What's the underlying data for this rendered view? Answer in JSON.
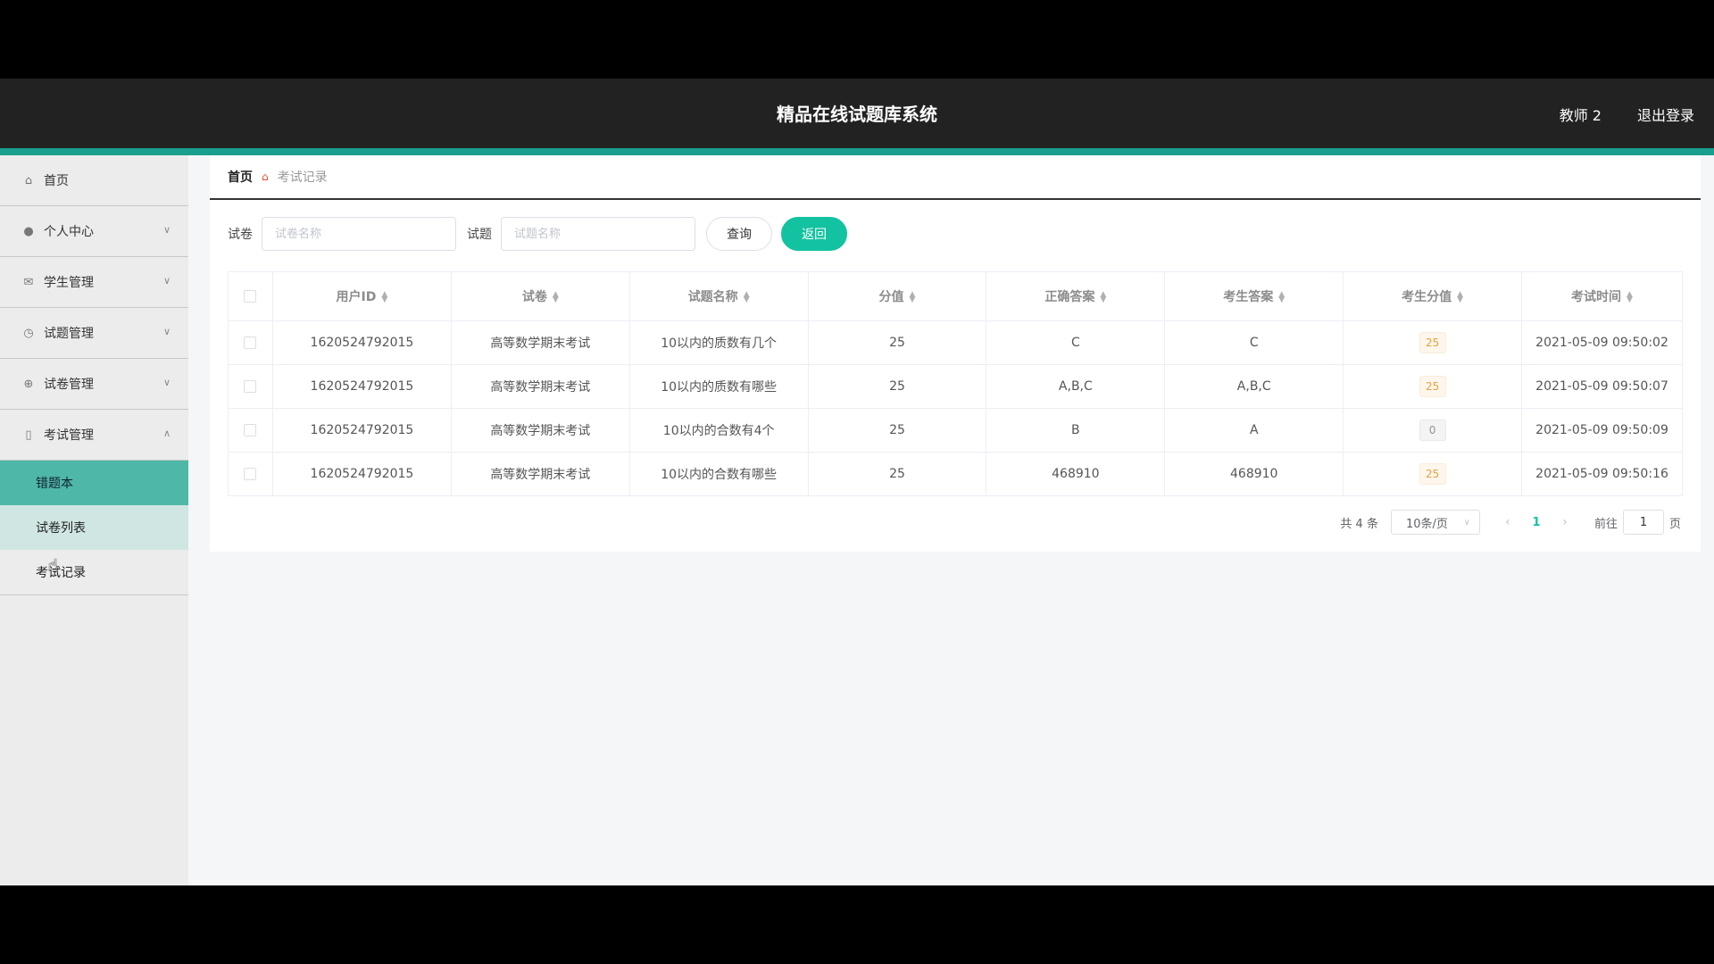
{
  "header": {
    "title": "精品在线试题库系统",
    "user": "教师 2",
    "logout": "退出登录"
  },
  "sidebar": {
    "items": [
      {
        "label": "首页",
        "icon": "home-icon"
      },
      {
        "label": "个人中心",
        "icon": "user-icon"
      },
      {
        "label": "学生管理",
        "icon": "mail-icon"
      },
      {
        "label": "试题管理",
        "icon": "clock-icon"
      },
      {
        "label": "试卷管理",
        "icon": "target-icon"
      },
      {
        "label": "考试管理",
        "icon": "clipboard-icon"
      }
    ],
    "subitems": [
      "错题本",
      "试卷列表",
      "考试记录"
    ]
  },
  "breadcrumb": {
    "home": "首页",
    "current": "考试记录"
  },
  "search": {
    "paper_label": "试卷",
    "paper_placeholder": "试卷名称",
    "question_label": "试题",
    "question_placeholder": "试题名称",
    "query_button": "查询",
    "back_button": "返回"
  },
  "table": {
    "columns": [
      "用户ID",
      "试卷",
      "试题名称",
      "分值",
      "正确答案",
      "考生答案",
      "考生分值",
      "考试时间"
    ],
    "rows": [
      {
        "user_id": "1620524792015",
        "paper": "高等数学期末考试",
        "question": "10以内的质数有几个",
        "score": "25",
        "correct": "C",
        "answer": "C",
        "got": "25",
        "time": "2021-05-09 09:50:02"
      },
      {
        "user_id": "1620524792015",
        "paper": "高等数学期末考试",
        "question": "10以内的质数有哪些",
        "score": "25",
        "correct": "A,B,C",
        "answer": "A,B,C",
        "got": "25",
        "time": "2021-05-09 09:50:07"
      },
      {
        "user_id": "1620524792015",
        "paper": "高等数学期末考试",
        "question": "10以内的合数有4个",
        "score": "25",
        "correct": "B",
        "answer": "A",
        "got": "0",
        "time": "2021-05-09 09:50:09"
      },
      {
        "user_id": "1620524792015",
        "paper": "高等数学期末考试",
        "question": "10以内的合数有哪些",
        "score": "25",
        "correct": "468910",
        "answer": "468910",
        "got": "25",
        "time": "2021-05-09 09:50:16"
      }
    ]
  },
  "pagination": {
    "total": "共 4 条",
    "page_size": "10条/页",
    "current": "1",
    "goto": "前往",
    "jump_value": "1",
    "page_suffix": "页"
  },
  "colors": {
    "accent": "#1a9e8d",
    "primary_button": "#13c2a0",
    "active_menu": "#4fb7a8"
  }
}
